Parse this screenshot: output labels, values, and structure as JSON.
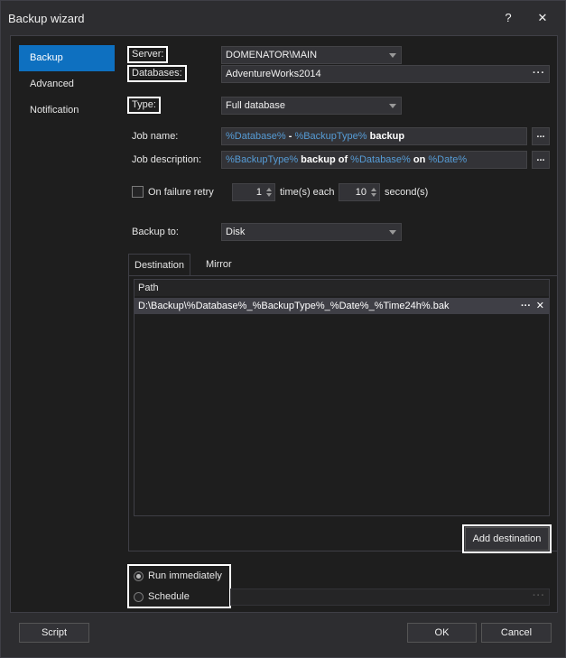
{
  "window": {
    "title": "Backup wizard",
    "help_label": "?",
    "close_label": "✕"
  },
  "sidebar": {
    "items": [
      {
        "label": "Backup"
      },
      {
        "label": "Advanced"
      },
      {
        "label": "Notification"
      }
    ]
  },
  "form": {
    "server_label": "Server:",
    "server_value": "DOMENATOR\\MAIN",
    "databases_label": "Databases:",
    "databases_value": "AdventureWorks2014",
    "databases_more": "···",
    "type_label": "Type:",
    "type_value": "Full database",
    "job_name_label": "Job name:",
    "job_name_parts": [
      "%Database%",
      " - ",
      "%BackupType%",
      " backup"
    ],
    "job_desc_label": "Job description:",
    "job_desc_parts": [
      "%BackupType%",
      " backup of ",
      "%Database%",
      " on ",
      "%Date%"
    ],
    "ellipsis_label": "...",
    "failure_retry_label": "On failure retry",
    "retry_count": "1",
    "times_each_label": "time(s) each",
    "retry_seconds": "10",
    "seconds_label": "second(s)",
    "backup_to_label": "Backup to:",
    "backup_to_value": "Disk"
  },
  "tabs": {
    "destination": "Destination",
    "mirror": "Mirror"
  },
  "grid": {
    "header": "Path",
    "rows": [
      {
        "path": "D:\\Backup\\%Database%_%BackupType%_%Date%_%Time24h%.bak",
        "more": "···",
        "remove": "✕"
      }
    ]
  },
  "add_destination_label": "Add destination",
  "run": {
    "immediately_label": "Run immediately",
    "schedule_label": "Schedule",
    "schedule_more": "···",
    "selected": "immediately"
  },
  "footer": {
    "script_label": "Script",
    "ok_label": "OK",
    "cancel_label": "Cancel"
  },
  "colors": {
    "accent": "#0e70c0",
    "token": "#569cd6"
  }
}
